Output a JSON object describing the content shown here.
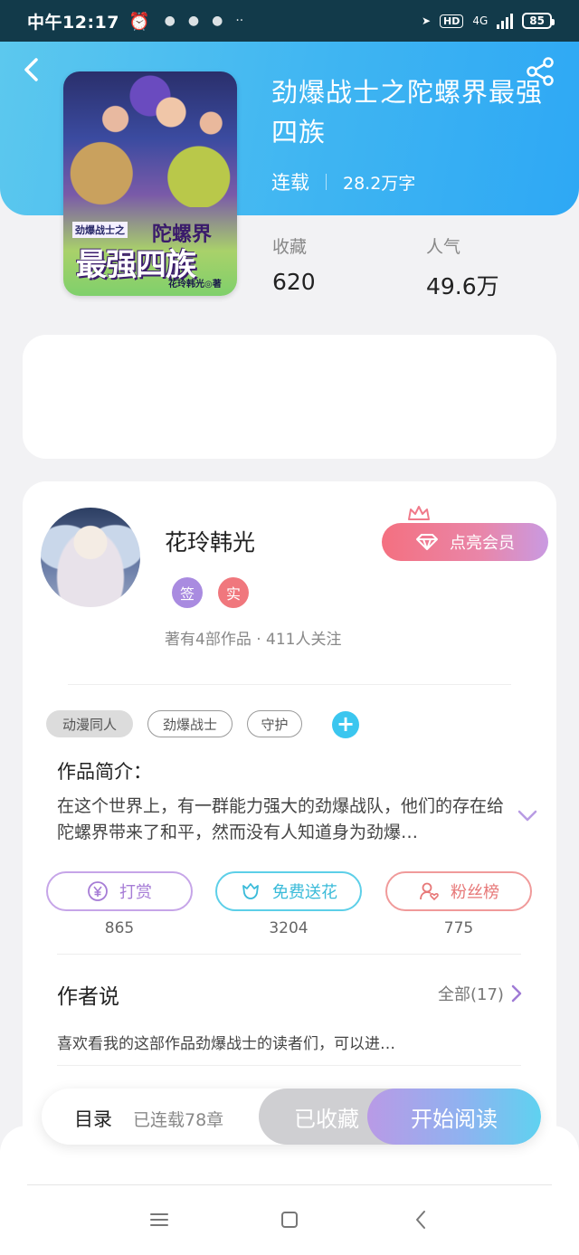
{
  "status_bar": {
    "time": "中午12:17",
    "network": "4G",
    "hd": "HD",
    "battery": "85"
  },
  "book": {
    "title": "劲爆战士之陀螺界最强四族",
    "status": "连载",
    "word_count": "28.2万字",
    "cover": {
      "series_label": "劲爆战士之",
      "title_line1": "陀螺界",
      "title_line2": "最强四族",
      "author_line": "花玲韩光◎著"
    }
  },
  "stats": {
    "favorites_label": "收藏",
    "favorites_value": "620",
    "popularity_label": "人气",
    "popularity_value": "49.6万"
  },
  "author": {
    "name": "花玲韩光",
    "badge_signed": "签",
    "badge_verified": "实",
    "stats_text": "著有4部作品 · 411人关注",
    "vip_button": "点亮会员"
  },
  "tags": [
    "动漫同人",
    "劲爆战士",
    "守护"
  ],
  "tag_add": "+",
  "intro": {
    "title": "作品简介：",
    "text": "在这个世界上，有一群能力强大的劲爆战队，他们的存在给陀螺界带来了和平，然而没有人知道身为劲爆…"
  },
  "actions": {
    "reward_label": "打赏",
    "reward_count": "865",
    "flower_label": "免费送花",
    "flower_count": "3204",
    "fans_label": "粉丝榜",
    "fans_count": "775"
  },
  "author_says": {
    "title": "作者说",
    "all_label": "全部(17)",
    "preview": "喜欢看我的这部作品劲爆战士的读者们，可以进…"
  },
  "bottom_bar": {
    "toc_label": "目录",
    "chapter_status": "已连载78章",
    "collected_label": "已收藏",
    "read_label": "开始阅读"
  },
  "colors": {
    "header_accent": "#3fb5f2",
    "vip_pink": "#f47080",
    "reward_purple": "#a67cd6",
    "flower_cyan": "#3abbd9",
    "fans_red": "#e77878"
  }
}
